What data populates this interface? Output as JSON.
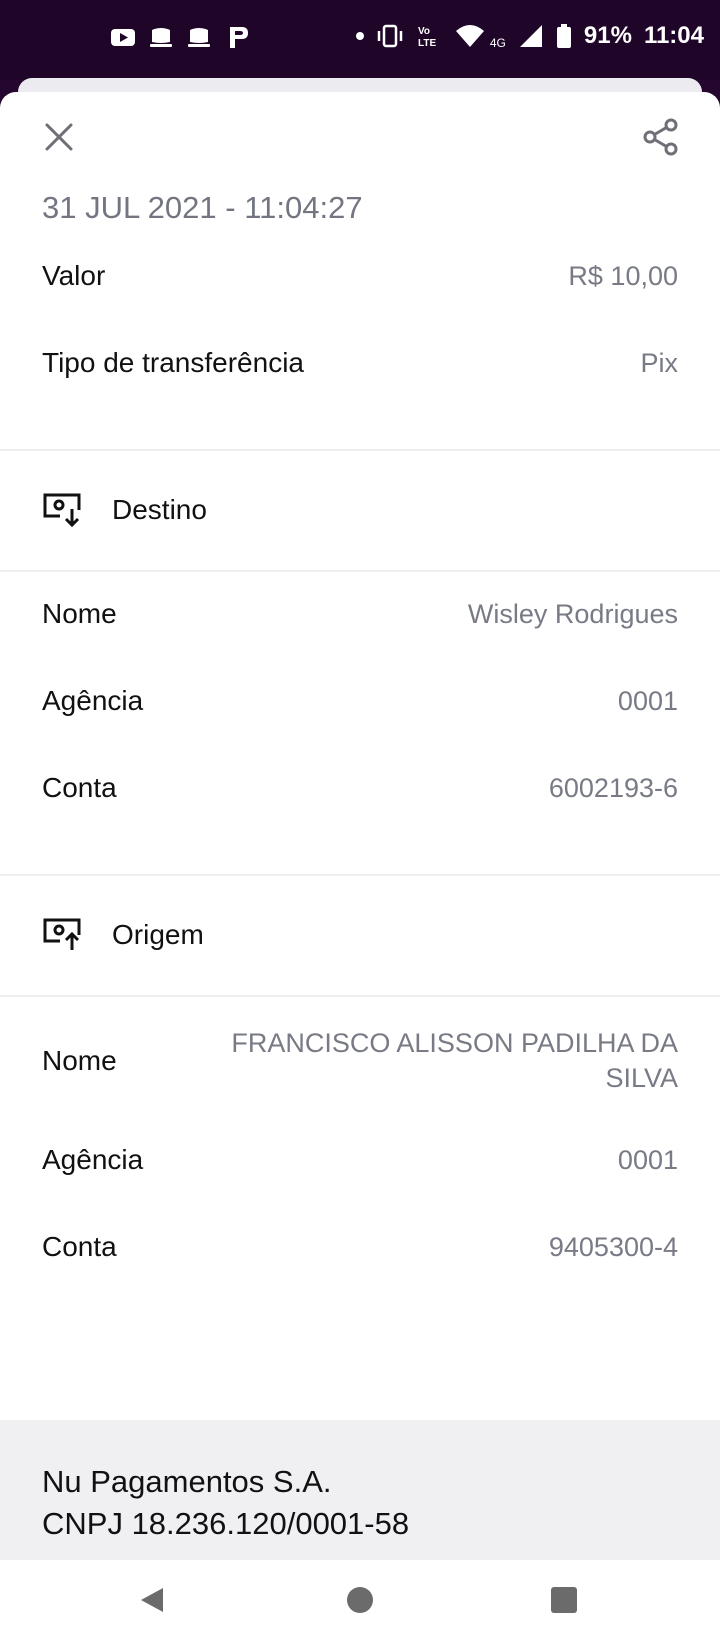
{
  "status_bar": {
    "battery": "91%",
    "time": "11:04",
    "network": "4G",
    "left_icons": [
      "youtube-icon",
      "app-icon",
      "app-icon",
      "pinterest-icon"
    ],
    "right_icons": [
      "dot-icon",
      "vibrate-icon",
      "volte-icon",
      "wifi-icon",
      "signal-icon",
      "battery-icon"
    ]
  },
  "header": {
    "close_icon": "close-icon",
    "share_icon": "share-icon",
    "date": "31 JUL 2021 - 11:04:27"
  },
  "summary": {
    "valor_label": "Valor",
    "valor_value": "R$ 10,00",
    "tipo_label": "Tipo de transferência",
    "tipo_value": "Pix"
  },
  "destino": {
    "title": "Destino",
    "icon": "receive-money-icon",
    "nome_label": "Nome",
    "nome_value": "Wisley Rodrigues",
    "agencia_label": "Agência",
    "agencia_value": "0001",
    "conta_label": "Conta",
    "conta_value": "6002193-6"
  },
  "origem": {
    "title": "Origem",
    "icon": "send-money-icon",
    "nome_label": "Nome",
    "nome_value": "FRANCISCO ALISSON PADILHA DA SILVA",
    "agencia_label": "Agência",
    "agencia_value": "0001",
    "conta_label": "Conta",
    "conta_value": "9405300-4"
  },
  "footer": {
    "company": "Nu Pagamentos S.A.",
    "cnpj": "CNPJ 18.236.120/0001-58"
  },
  "colors": {
    "status_bar": "#1f0528",
    "text_primary": "#111111",
    "text_secondary": "#787b85",
    "divider": "#eeeef1",
    "footer_bg": "#f0f0f3"
  }
}
